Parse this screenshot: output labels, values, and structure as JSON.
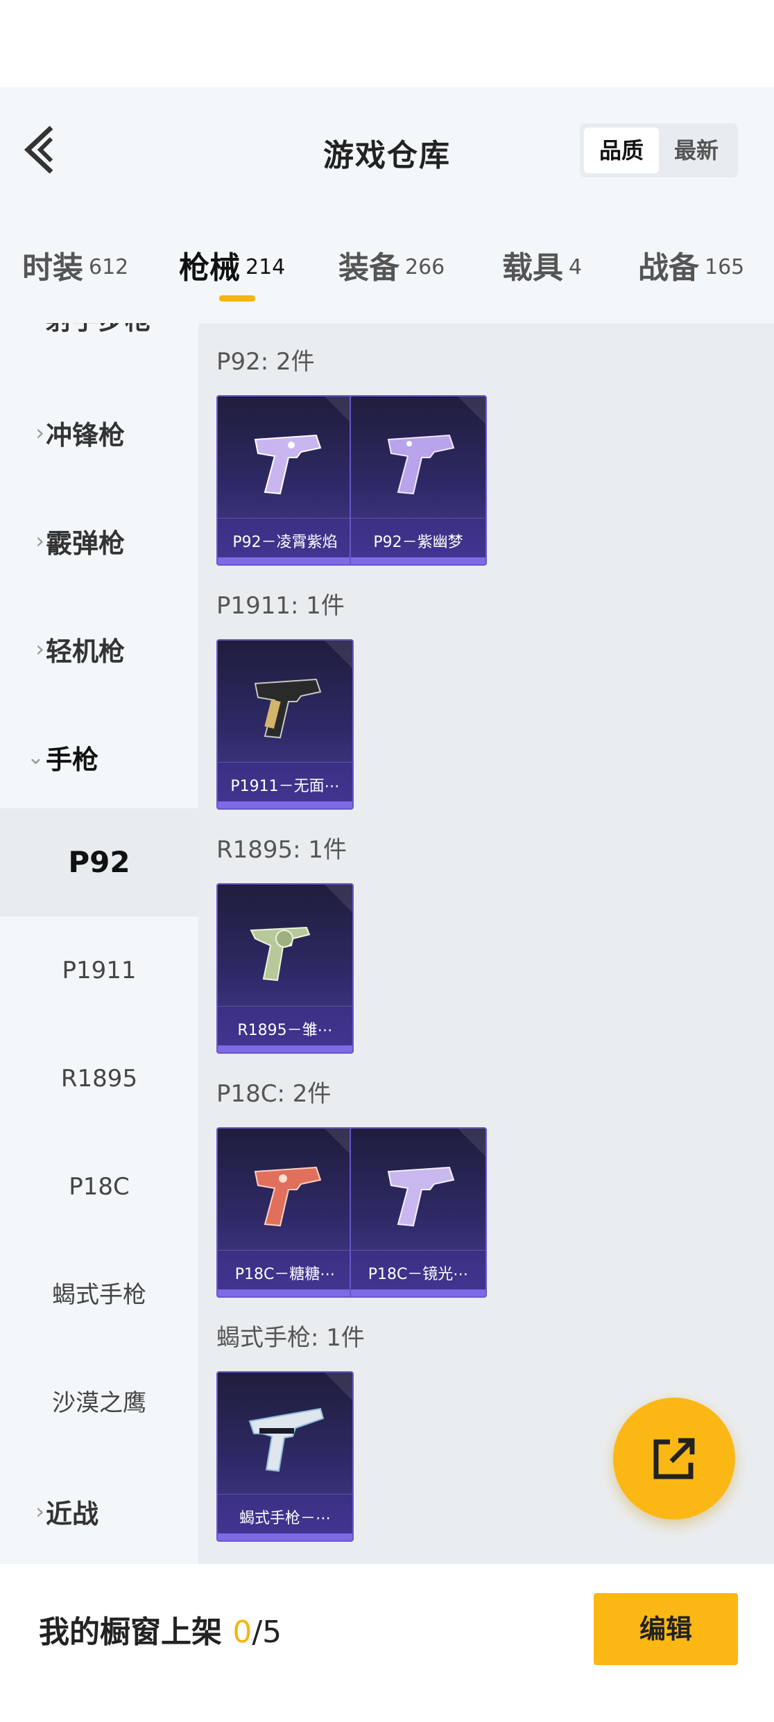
{
  "header": {
    "title": "游戏仓库",
    "back_icon": "chevron-left-icon",
    "sort": [
      "品质",
      "最新"
    ],
    "tabs": [
      {
        "label": "时装",
        "count": "612"
      },
      {
        "label": "枪械",
        "count": "214"
      },
      {
        "label": "装备",
        "count": "266"
      },
      {
        "label": "载具",
        "count": "4"
      },
      {
        "label": "战备",
        "count": "165"
      }
    ]
  },
  "sidebar": {
    "categories": [
      {
        "label": "射手步枪"
      },
      {
        "label": "冲锋枪"
      },
      {
        "label": "霰弹枪"
      },
      {
        "label": "轻机枪"
      },
      {
        "label": "手枪"
      },
      {
        "label": "近战"
      }
    ],
    "subitems": [
      "P92",
      "P1911",
      "R1895",
      "P18C",
      "蝎式手枪",
      "沙漠之鹰"
    ]
  },
  "groups": [
    {
      "title": "P92: 2件",
      "items": [
        "P92－凌霄紫焰",
        "P92－紫幽梦"
      ]
    },
    {
      "title": "P1911: 1件",
      "items": [
        "P1911－无面⋯"
      ]
    },
    {
      "title": "R1895: 1件",
      "items": [
        "R1895－雏⋯"
      ]
    },
    {
      "title": "P18C: 2件",
      "items": [
        "P18C－糖糖⋯",
        "P18C－镜光⋯"
      ]
    },
    {
      "title": "蝎式手枪: 1件",
      "items": [
        "蝎式手枪－⋯"
      ]
    }
  ],
  "fab_icon": "share-external-icon",
  "footer": {
    "label": "我的橱窗上架",
    "current": "0",
    "total": "/5",
    "edit": "编辑"
  },
  "colors": {
    "accent": "#fbb815",
    "card_purple": "#2f2a68"
  }
}
